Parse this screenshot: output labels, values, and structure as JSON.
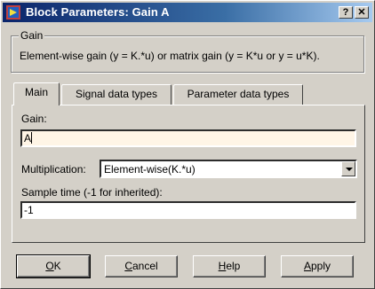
{
  "window": {
    "title": "Block Parameters: Gain A",
    "help_label": "?",
    "close_label": "✕"
  },
  "group": {
    "legend": "Gain",
    "description": "Element-wise gain (y = K.*u) or matrix gain (y = K*u or y = u*K)."
  },
  "tabs": [
    {
      "label": "Main",
      "selected": true
    },
    {
      "label": "Signal data types",
      "selected": false
    },
    {
      "label": "Parameter data types",
      "selected": false
    }
  ],
  "main": {
    "gain_label": "Gain:",
    "gain_value": "A",
    "multiplication_label": "Multiplication:",
    "multiplication_value": "Element-wise(K.*u)",
    "sample_time_label": "Sample time (-1 for inherited):",
    "sample_time_value": "-1"
  },
  "buttons": {
    "ok_mnemonic": "O",
    "ok_rest": "K",
    "cancel_mnemonic": "C",
    "cancel_rest": "ancel",
    "help_mnemonic": "H",
    "help_rest": "elp",
    "apply_mnemonic": "A",
    "apply_rest": "pply"
  },
  "colors": {
    "titlebar_start": "#0a246a",
    "titlebar_end": "#a6caf0",
    "face": "#d4d0c8",
    "focused_field": "#fff5e6"
  }
}
